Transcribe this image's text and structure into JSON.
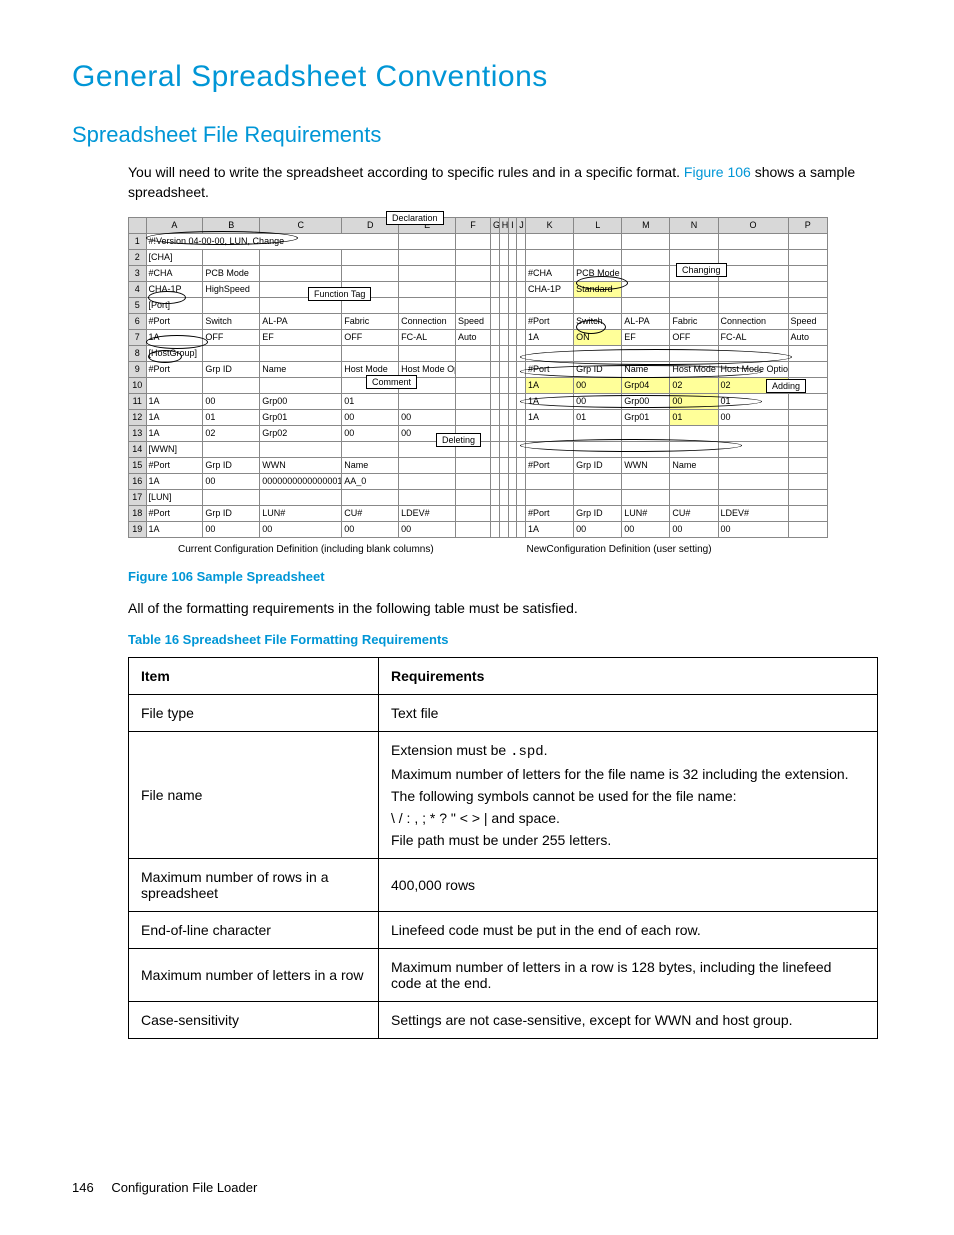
{
  "h1": "General Spreadsheet Conventions",
  "h2": "Spreadsheet File Requirements",
  "intro_a": "You will need to write the spreadsheet according to specific rules and in a specific format. ",
  "intro_link": "Figure 106",
  "intro_b": " shows a sample spreadsheet.",
  "sheet": {
    "row1": "#!Version 04-00-00, LUN, Change",
    "row2": "[CHA]",
    "r3": {
      "a": "#CHA",
      "b": "PCB Mode"
    },
    "r4": {
      "a": "CHA-1P",
      "b": "HighSpeed"
    },
    "r5": "[Port]",
    "r6": {
      "a": "#Port",
      "b": "Switch",
      "c": "AL-PA",
      "d": "Fabric",
      "e": "Connection",
      "f": "Speed"
    },
    "r7": {
      "a": "1A",
      "b": "OFF",
      "c": "EF",
      "d": "OFF",
      "e": "FC-AL",
      "f": "Auto"
    },
    "r8": "[HostGroup]",
    "r9": {
      "a": "#Port",
      "b": "Grp ID",
      "c": "Name",
      "d": "Host Mode",
      "e": "Host Mode Option"
    },
    "r11": {
      "a": "1A",
      "b": "00",
      "c": "Grp00",
      "d": "01"
    },
    "r12": {
      "a": "1A",
      "b": "01",
      "c": "Grp01",
      "d": "00",
      "e": "00"
    },
    "r13": {
      "a": "1A",
      "b": "02",
      "c": "Grp02",
      "d": "00",
      "e": "00"
    },
    "r14": "[WWN]",
    "r15": {
      "a": "#Port",
      "b": "Grp ID",
      "c": "WWN",
      "d": "Name"
    },
    "r16": {
      "a": "1A",
      "b": "00",
      "c": "0000000000000001",
      "d": "AA_0"
    },
    "r17": "[LUN]",
    "r18": {
      "a": "#Port",
      "b": "Grp ID",
      "c": "LUN#",
      "d": "CU#",
      "e": "LDEV#"
    },
    "r19": {
      "a": "1A",
      "b": "00",
      "c": "00",
      "d": "00",
      "e": "00"
    },
    "right": {
      "r3": {
        "a": "#CHA",
        "b": "PCB Mode"
      },
      "r4": {
        "a": "CHA-1P",
        "b": "Standard"
      },
      "r6": {
        "a": "#Port",
        "b": "Switch",
        "c": "AL-PA",
        "d": "Fabric",
        "e": "Connection",
        "f": "Speed"
      },
      "r7": {
        "a": "1A",
        "b": "ON",
        "c": "EF",
        "d": "OFF",
        "e": "FC-AL",
        "f": "Auto"
      },
      "r9": {
        "a": "#Port",
        "b": "Grp ID",
        "c": "Name",
        "d": "Host Mode",
        "e": "Host Mode Option"
      },
      "r10": {
        "a": "1A",
        "b": "00",
        "c": "Grp04",
        "d": "02",
        "e": "02"
      },
      "r11": {
        "a": "1A",
        "b": "00",
        "c": "Grp00",
        "d": "00",
        "e": "01"
      },
      "r12": {
        "a": "1A",
        "b": "01",
        "c": "Grp01",
        "d": "01",
        "e": "00"
      },
      "r15": {
        "a": "#Port",
        "b": "Grp ID",
        "c": "WWN",
        "d": "Name"
      },
      "r18": {
        "a": "#Port",
        "b": "Grp ID",
        "c": "LUN#",
        "d": "CU#",
        "e": "LDEV#"
      },
      "r19": {
        "a": "1A",
        "b": "00",
        "c": "00",
        "d": "00",
        "e": "00"
      }
    },
    "callouts": {
      "declaration": "Declaration",
      "function": "Function Tag",
      "comment": "Comment",
      "deleting": "Deleting",
      "changing": "Changing",
      "adding": "Adding"
    },
    "cap_left": "Current Configuration Definition (including blank columns)",
    "cap_right": "NewConfiguration Definition (user setting)"
  },
  "fig_caption": "Figure 106 Sample Spreadsheet",
  "satisfied": "All of the formatting requirements in the following table must be satisfied.",
  "tbl_caption": "Table 16 Spreadsheet File Formatting Requirements",
  "req": {
    "h1": "Item",
    "h2": "Requirements",
    "rows": [
      {
        "item": "File type",
        "req": "Text file"
      },
      {
        "item": "File name",
        "req_lines": [
          "Extension must be <span class=\"mono\">.spd</span>.",
          "Maximum number of letters for the file name is 32 including the extension.",
          "The following symbols cannot be used for the file name:",
          "\\ / : , ; * ? \" &lt; &gt; | and space.",
          "File path must be under 255 letters."
        ]
      },
      {
        "item": "Maximum number of rows in a spreadsheet",
        "req": "400,000 rows"
      },
      {
        "item": "End-of-line character",
        "req": "Linefeed code must be put in the end of each row."
      },
      {
        "item": "Maximum number of letters in a row",
        "req": "Maximum number of letters in a row is 128 bytes, including the linefeed code at the end."
      },
      {
        "item": "Case-sensitivity",
        "req": "Settings are not case-sensitive, except for WWN and host group."
      }
    ]
  },
  "footer_page": "146",
  "footer_title": "Configuration File Loader"
}
